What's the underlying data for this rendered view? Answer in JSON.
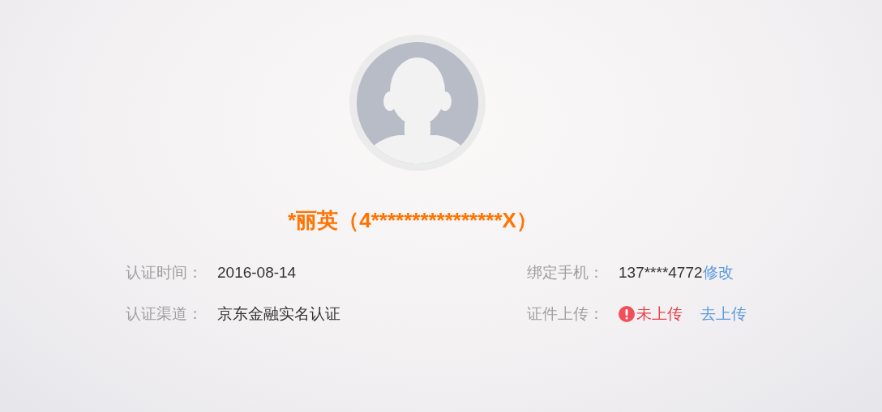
{
  "profile": {
    "name": "*丽英（4****************X）"
  },
  "details": [
    {
      "label": "认证时间：",
      "value": "2016-08-14"
    },
    {
      "label": "绑定手机：",
      "value": "137****4772",
      "link": "修改"
    },
    {
      "label": "认证渠道：",
      "value": "京东金融实名认证"
    },
    {
      "label": "证件上传：",
      "status": {
        "kind": "error",
        "text": "未上传"
      },
      "link": "去上传"
    }
  ]
}
